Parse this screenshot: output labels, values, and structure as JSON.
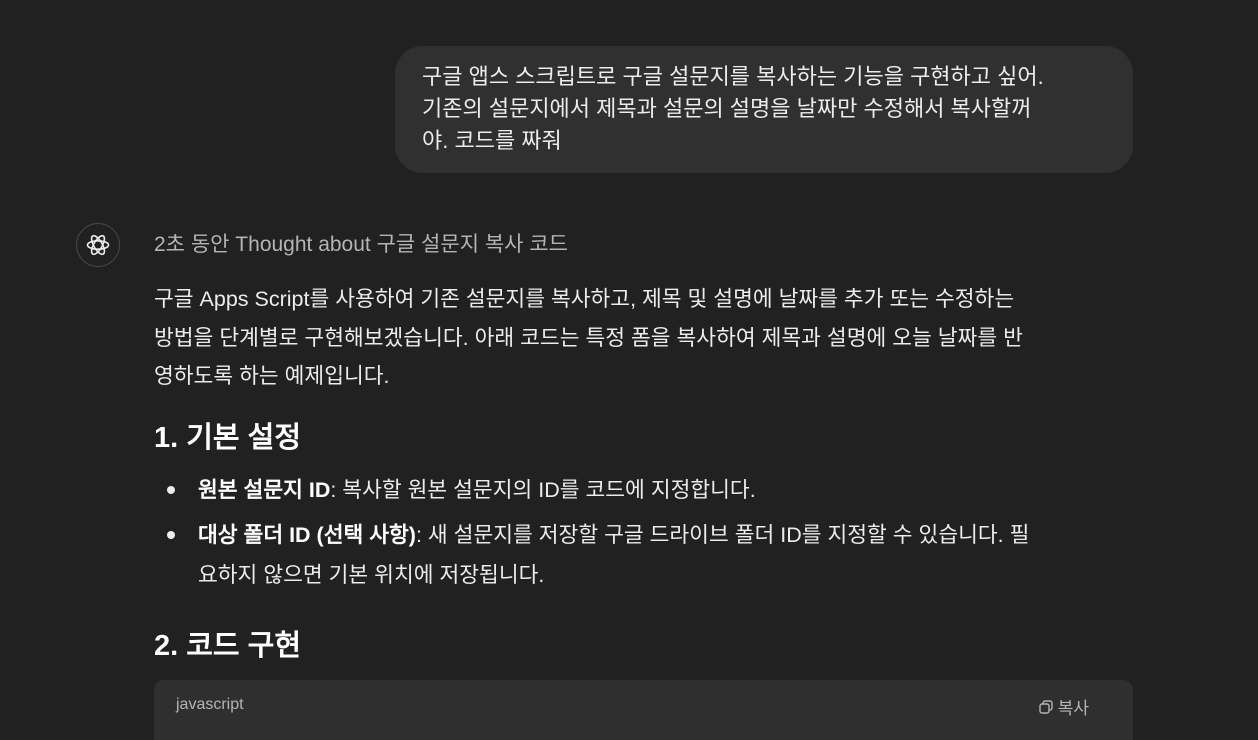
{
  "user_message": {
    "lines": [
      "구글 앱스 스크립트로 구글 설문지를 복사하는 기능을 구현하고 싶어.",
      "기존의 설문지에서 제목과 설문의 설명을 날짜만 수정해서 복사할꺼",
      "야. 코드를 짜줘"
    ]
  },
  "assistant": {
    "avatar_icon": "openai-logo-icon",
    "thought_label": "2초 동안 Thought about 구글 설문지 복사 코드",
    "intro_lines": [
      "구글 Apps Script를 사용하여 기존 설문지를 복사하고, 제목 및 설명에 날짜를 추가 또는 수정하는",
      "방법을 단계별로 구현해보겠습니다. 아래 코드는 특정 폼을 복사하여 제목과 설명에 오늘 날짜를 반",
      "영하도록 하는 예제입니다."
    ],
    "section1_title": "1. 기본 설정",
    "bullets": [
      {
        "bold": "원본 설문지 ID",
        "text": ": 복사할 원본 설문지의 ID를 코드에 지정합니다."
      },
      {
        "bold": "대상 폴더 ID (선택 사항)",
        "text": ": 새 설문지를 저장할 구글 드라이브 폴더 ID를 지정할 수 있습니다. 필",
        "text2": "요하지 않으면 기본 위치에 저장됩니다."
      }
    ],
    "section2_title": "2. 코드 구현",
    "code_block": {
      "language": "javascript",
      "copy_label": "복사",
      "copy_icon": "copy-icon"
    }
  }
}
